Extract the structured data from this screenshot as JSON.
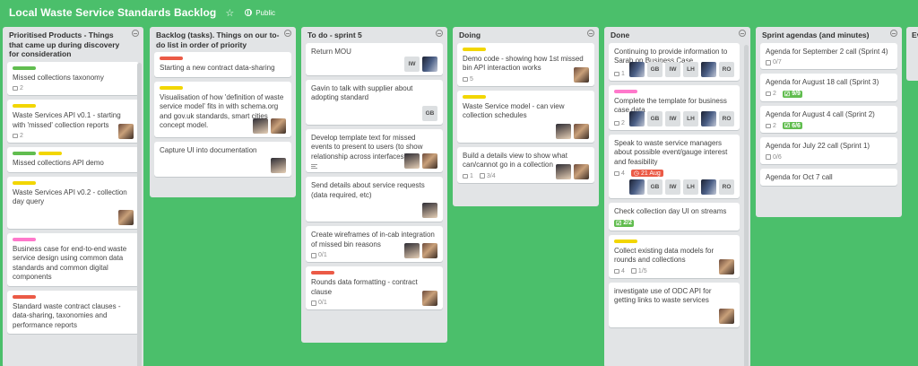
{
  "board": {
    "title": "Local Waste Service Standards Backlog",
    "star": "☆",
    "visibility": "Public"
  },
  "colors": {
    "green": "#61bd4f",
    "yellow": "#f2d600",
    "red": "#eb5a46",
    "pink": "#ff78cb",
    "blue": "#0079bf"
  },
  "lists": [
    {
      "title": "Prioritised Products - Things that came up during discovery for consideration",
      "cards": [
        {
          "labels": [
            "green"
          ],
          "title": "Missed collections taxonomy",
          "comments": "2"
        },
        {
          "labels": [
            "yellow"
          ],
          "title": "Waste Services API v0.1 - starting with 'missed' collection reports",
          "comments": "2"
        },
        {
          "labels": [
            "green",
            "yellow"
          ],
          "title": "Missed collections API demo"
        },
        {
          "labels": [
            "yellow"
          ],
          "title": "Waste Services API v0.2 - collection day query"
        },
        {
          "labels": [
            "pink"
          ],
          "title": "Business case for end-to-end waste service design using common data standards and common digital components"
        },
        {
          "labels": [
            "red"
          ],
          "title": "Standard waste contract clauses - data-sharing, taxonomies and performance reports"
        }
      ]
    },
    {
      "title": "Backlog (tasks). Things on our to-do list in order of priority",
      "cards": [
        {
          "labels": [
            "red"
          ],
          "title": "Starting a new contract data-sharing"
        },
        {
          "labels": [
            "yellow"
          ],
          "title": "Visualisation of how 'definition of waste service model' fits in with schema.org and gov.uk standards, smart cities concept model."
        },
        {
          "title": "Capture UI into documentation"
        }
      ]
    },
    {
      "title": "To do - sprint 5",
      "cards": [
        {
          "title": "Return MOU",
          "initials": [
            "IW"
          ]
        },
        {
          "title": "Gavin to talk with supplier about adopting standard",
          "initials": [
            "GB"
          ]
        },
        {
          "title": "Develop template text for missed events to present to users (to show relationship across interfaces)"
        },
        {
          "title": "Send details about service requests (data required, etc)"
        },
        {
          "title": "Create wireframes of in-cab integration of missed bin reasons",
          "checklist": "0/1"
        },
        {
          "labels": [
            "red"
          ],
          "title": "Rounds data formatting - contract clause",
          "checklist": "0/1"
        }
      ]
    },
    {
      "title": "Doing",
      "cards": [
        {
          "labels": [
            "yellow"
          ],
          "title": "Demo code - showing how 1st missed bin API interaction works",
          "comments": "5"
        },
        {
          "labels": [
            "yellow"
          ],
          "title": "Waste Service model - can view collection schedules"
        },
        {
          "title": "Build a details view to show what can/cannot go in a collection",
          "comments": "1",
          "checklist": "3/4"
        }
      ]
    },
    {
      "title": "Done",
      "cards": [
        {
          "title": "Continuing to provide information to Sarah on Business Case",
          "comments": "1",
          "initials": [
            "GB",
            "IW",
            "LH",
            "RO"
          ]
        },
        {
          "labels": [
            "pink"
          ],
          "title": "Complete the template for business case data",
          "comments": "2",
          "initials": [
            "GB",
            "IW",
            "LH",
            "RO"
          ]
        },
        {
          "title": "Speak to waste service managers about possible event/gauge interest and feasibility",
          "comments": "4",
          "due": "21 Aug",
          "initials": [
            "GB",
            "IW",
            "LH",
            "RO"
          ]
        },
        {
          "title": "Check collection day UI on streams",
          "checklist": "2/2"
        },
        {
          "labels": [
            "yellow"
          ],
          "title": "Collect existing data models for rounds and collections",
          "comments": "4",
          "checklist": "1/5"
        },
        {
          "title": "investigate use of ODC API for getting links to waste services"
        }
      ]
    },
    {
      "title": "Sprint agendas (and minutes)",
      "cards": [
        {
          "title": "Agenda for September 2 call (Sprint 4)",
          "checklist": "0/7"
        },
        {
          "title": "Agenda for August 18 call (Sprint 3)",
          "comments": "2",
          "checklist": "9/9"
        },
        {
          "title": "Agenda for August 4 call (Sprint 2)",
          "comments": "2",
          "checklist": "6/6"
        },
        {
          "title": "Agenda for July 22 call (Sprint 1)",
          "checklist": "0/6"
        },
        {
          "title": "Agenda for Oct 7 call"
        }
      ]
    },
    {
      "title": "Ev"
    }
  ]
}
